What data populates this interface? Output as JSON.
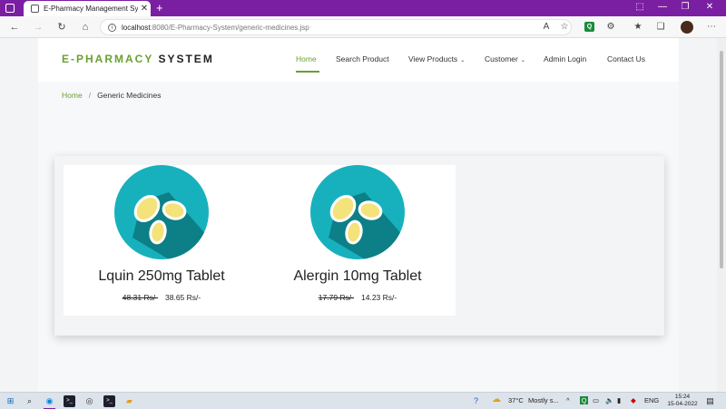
{
  "browser": {
    "tab_title": "E-Pharmacy Management System",
    "tab_title_display": "E-Pharmacy Management Syste",
    "url_host": "localhost",
    "url_path": ":8080/E-Pharmacy-System/generic-medicines.jsp"
  },
  "site": {
    "brand_part1": "E-PHARMACY",
    "brand_part2": "SYSTEM",
    "brand_color": "#6aa12f",
    "nav": [
      {
        "label": "Home"
      },
      {
        "label": "Search Product"
      },
      {
        "label": "View Products"
      },
      {
        "label": "Customer"
      },
      {
        "label": "Admin Login"
      },
      {
        "label": "Contact Us"
      }
    ]
  },
  "breadcrumb": {
    "home": "Home",
    "sep": "/",
    "current": "Generic Medicines"
  },
  "products": [
    {
      "name": "Lquin 250mg Tablet",
      "old_price": "48.31 Rs/-",
      "new_price": "38.65 Rs/-"
    },
    {
      "name": "Alergin 10mg Tablet",
      "old_price": "17.79 Rs/-",
      "new_price": "14.23 Rs/-"
    }
  ],
  "taskbar": {
    "weather": "37°C",
    "weather_text": "Mostly s...",
    "lang": "ENG",
    "time": "15:24",
    "date": "15-04-2022"
  }
}
